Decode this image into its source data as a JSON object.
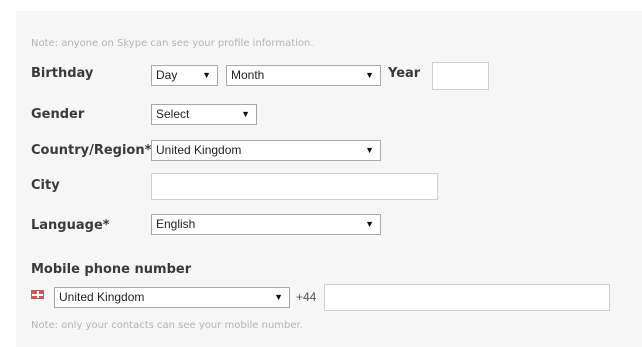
{
  "profile_note": "Note: anyone on Skype can see your profile information.",
  "birthday": {
    "label": "Birthday",
    "day": "Day",
    "month": "Month",
    "year_label": "Year",
    "year_value": ""
  },
  "gender": {
    "label": "Gender",
    "value": "Select"
  },
  "country": {
    "label": "Country/Region*",
    "value": "United Kingdom"
  },
  "city": {
    "label": "City",
    "value": ""
  },
  "language": {
    "label": "Language*",
    "value": "English"
  },
  "mobile": {
    "label": "Mobile phone number",
    "country": "United Kingdom",
    "prefix": "+44",
    "number": "",
    "note": "Note: only your contacts can see your mobile number."
  },
  "icons": {
    "dropdown": "chevron-down-icon",
    "flag": "uk-flag-icon"
  }
}
